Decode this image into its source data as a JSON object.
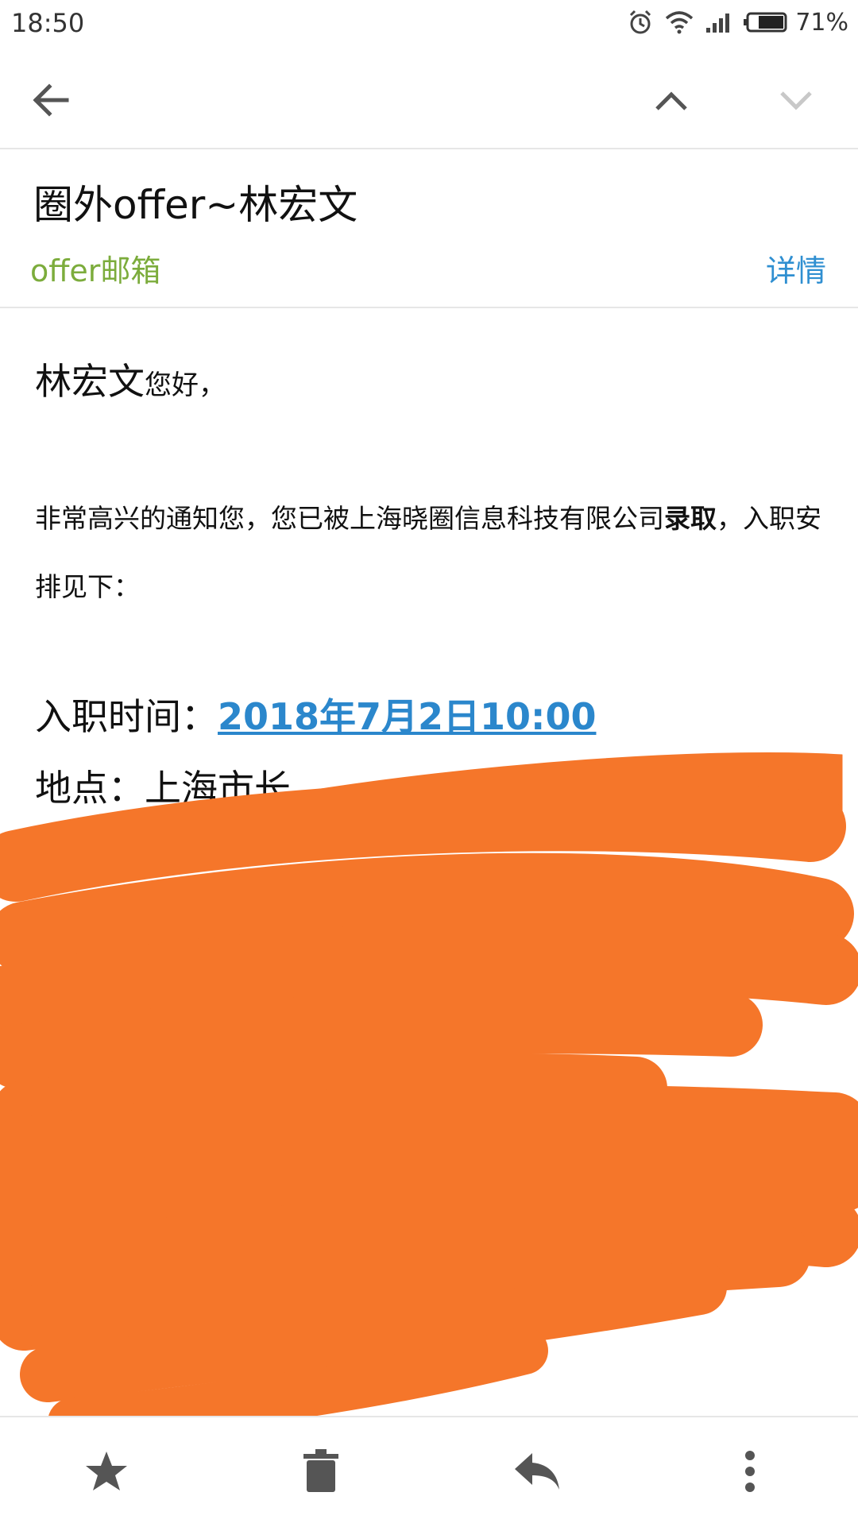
{
  "status_bar": {
    "time": "18:50",
    "battery_percent": "71%",
    "icons": [
      "alarm-icon",
      "wifi-icon",
      "signal-icon",
      "battery-icon"
    ]
  },
  "app_bar": {
    "icons": [
      "back-arrow-icon",
      "chevron-up-icon",
      "chevron-down-icon"
    ]
  },
  "email": {
    "subject": "圈外offer~林宏文",
    "sender": "offer邮箱",
    "details_label": "详情",
    "greeting_name": "林宏文",
    "greeting_suffix": "您好，",
    "para_part1": "非常高兴的通知您，您已被上海晓圈信息科技有限公司",
    "para_bold": "录取",
    "para_part2": "，入职安排见下：",
    "time_label": "入职时间：",
    "time_value": "2018年7月2日10:00",
    "place_label": "地点：",
    "place_visible": "上海市长"
  },
  "toolbar": {
    "icons": [
      "star-icon",
      "trash-icon",
      "reply-icon",
      "more-vert-icon"
    ]
  },
  "colors": {
    "sender_green": "#7cac3c",
    "link_blue": "#2b87cc",
    "redaction_orange": "#f5762a"
  }
}
